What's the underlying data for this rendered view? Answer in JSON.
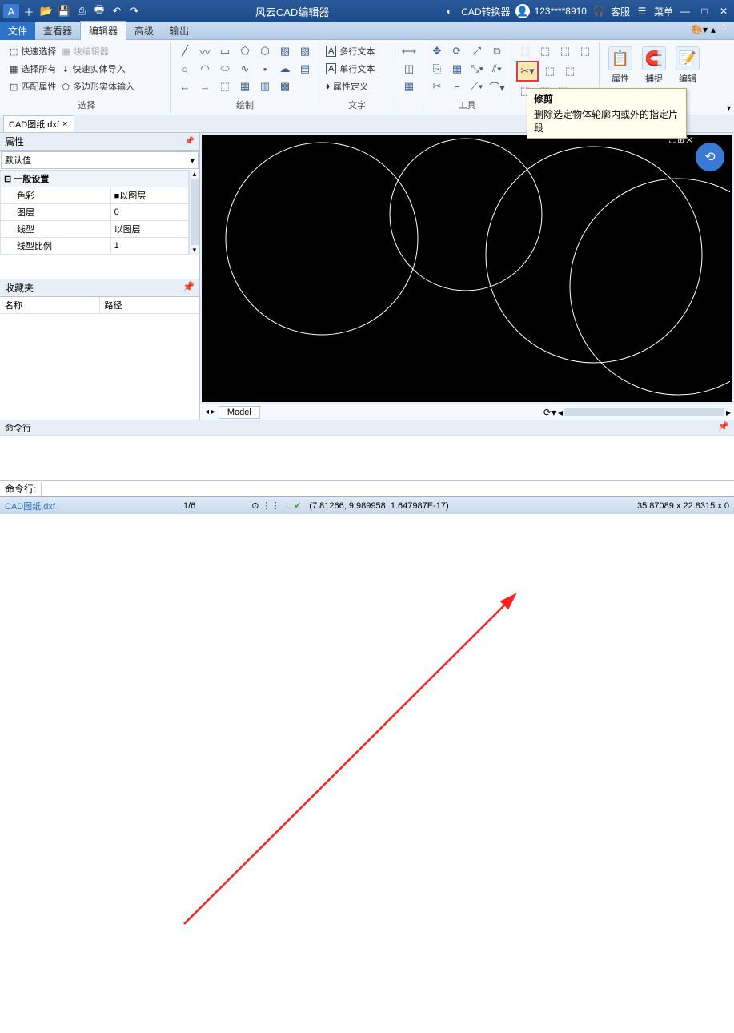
{
  "titlebar": {
    "app_name": "风云CAD编辑器",
    "converter": "CAD转换器",
    "user": "123****8910",
    "support": "客服",
    "menu": "菜单"
  },
  "menus": {
    "file": "文件",
    "viewer": "查看器",
    "editor": "编辑器",
    "advanced": "高级",
    "output": "输出"
  },
  "ribbon": {
    "select": {
      "quick": "快速选择",
      "all": "选择所有",
      "match": "匹配属性",
      "block_editor": "块编辑器",
      "quick_import": "快速实体导入",
      "poly_input": "多边形实体输入",
      "label": "选择"
    },
    "draw_label": "绘制",
    "text": {
      "multi": "多行文本",
      "single": "单行文本",
      "attr": "属性定义",
      "label": "文字"
    },
    "tool_label": "工具",
    "props": "属性",
    "snap": "捕捉",
    "edit": "编辑"
  },
  "tooltip": {
    "title": "修剪",
    "desc": "删除选定物体轮廓内或外的指定片段"
  },
  "file_tab": "CAD图纸.dxf",
  "properties": {
    "panel": "属性",
    "default": "默认值",
    "group": "一般设置",
    "color_k": "色彩",
    "color_v": "以图层",
    "layer_k": "图层",
    "layer_v": "0",
    "ltype_k": "线型",
    "ltype_v": "以图层",
    "lscale_k": "线型比例",
    "lscale_v": "1"
  },
  "favorites": {
    "panel": "收藏夹",
    "name": "名称",
    "path": "路径"
  },
  "model_tab": "Model",
  "cmd": {
    "hdr": "命令行",
    "prompt": "命令行:"
  },
  "status": {
    "file": "CAD图纸.dxf",
    "page": "1/6",
    "coords": "(7.81266; 9.989958; 1.647987E-17)",
    "dims": "35.87089 x 22.8315 x 0"
  }
}
